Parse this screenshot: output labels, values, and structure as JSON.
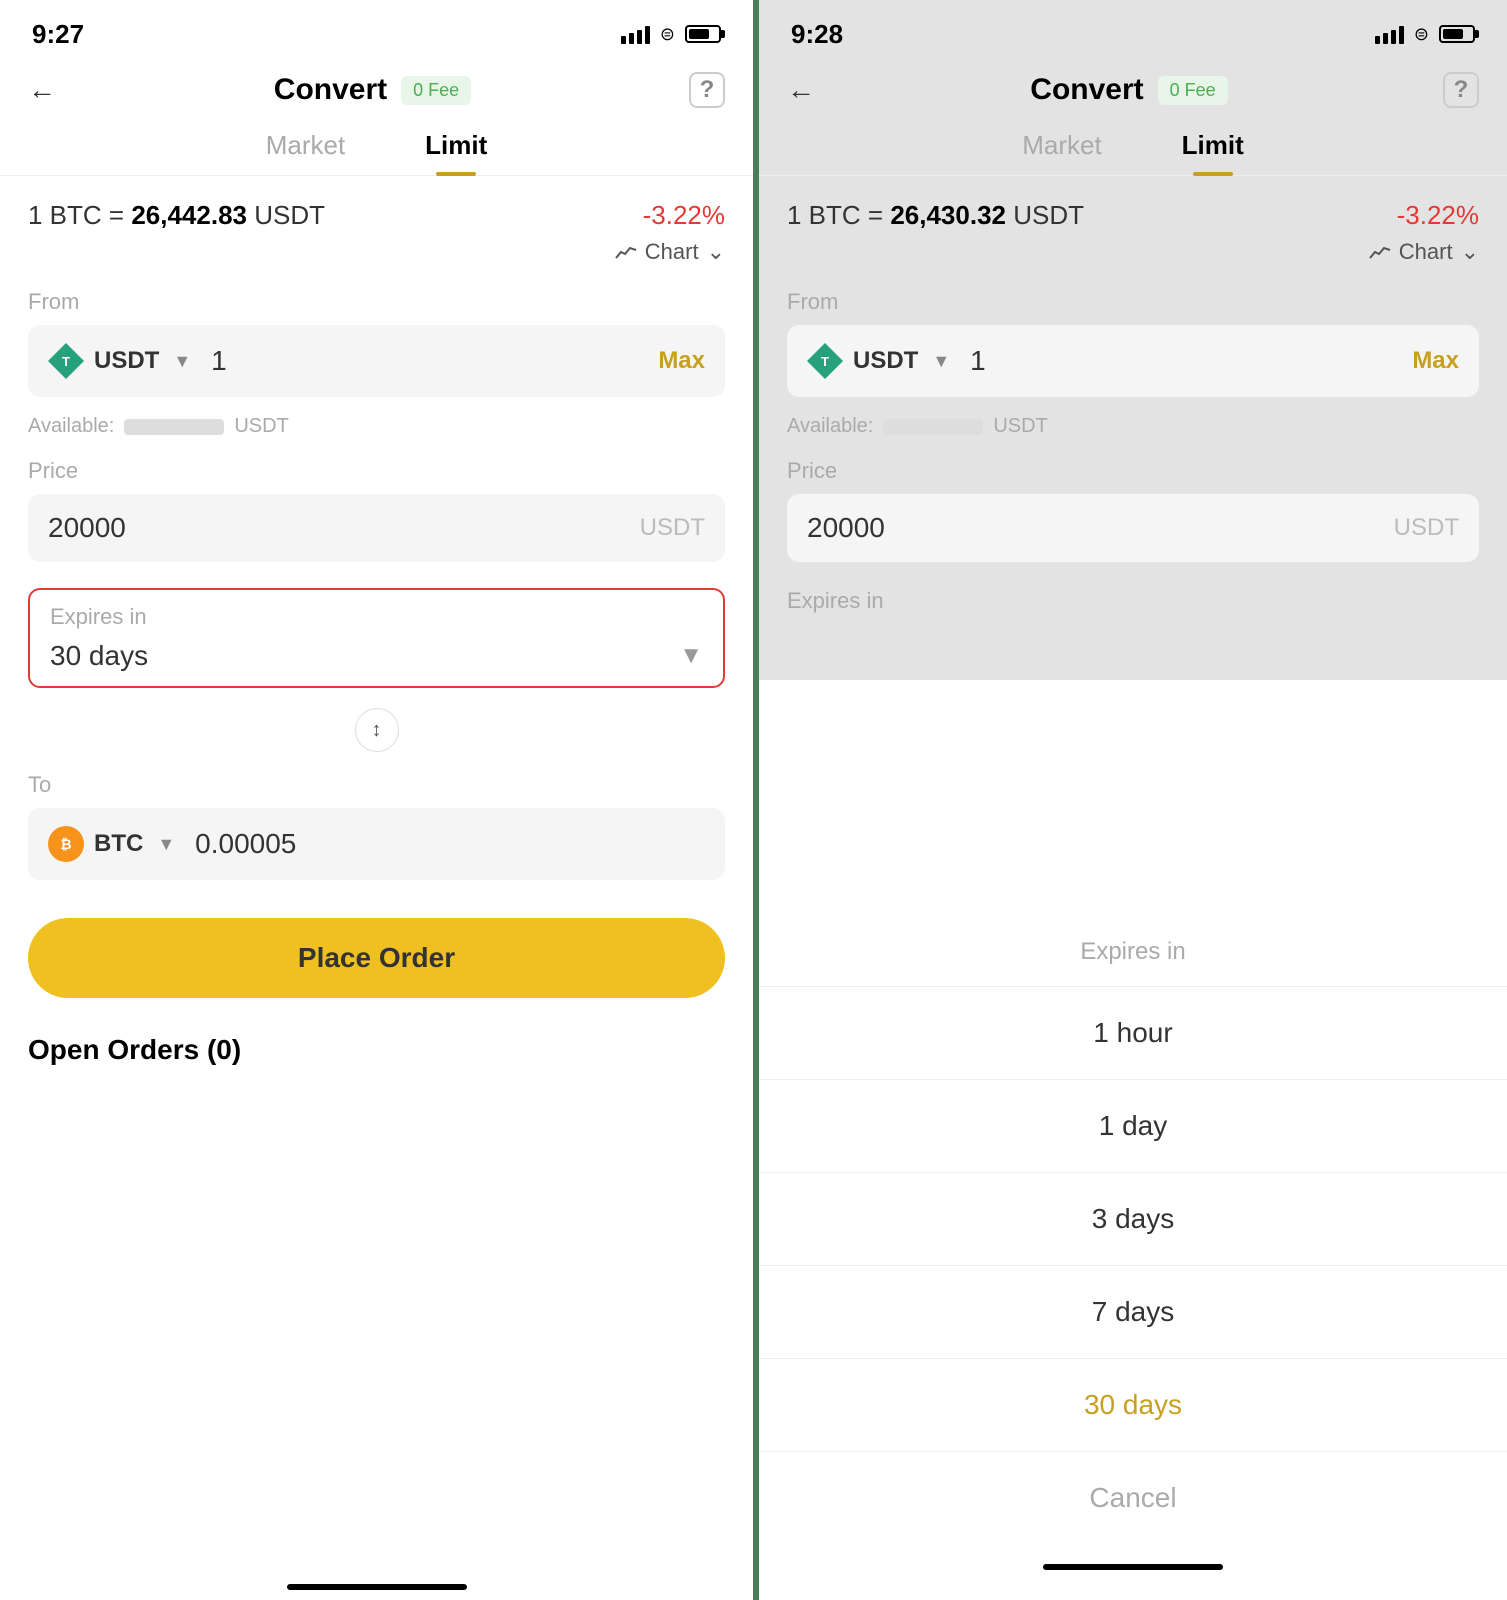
{
  "left": {
    "statusBar": {
      "time": "9:27"
    },
    "nav": {
      "title": "Convert",
      "feeBadge": "0 Fee"
    },
    "tabs": {
      "market": "Market",
      "limit": "Limit"
    },
    "rate": {
      "prefix": "1 BTC =",
      "value": "26,442.83",
      "unit": "USDT",
      "change": "-3.22%"
    },
    "chart": {
      "label": "Chart",
      "chevron": "⌄"
    },
    "from": {
      "label": "From",
      "currency": "USDT",
      "value": "1",
      "maxLabel": "Max",
      "availableLabel": "Available:",
      "availableUnit": "USDT"
    },
    "price": {
      "label": "Price",
      "value": "20000",
      "unit": "USDT"
    },
    "expires": {
      "label": "Expires in",
      "value": "30 days"
    },
    "to": {
      "label": "To",
      "currency": "BTC",
      "value": "0.00005"
    },
    "placeOrder": {
      "label": "Place Order"
    },
    "openOrders": {
      "label": "Open Orders (0)"
    }
  },
  "right": {
    "statusBar": {
      "time": "9:28"
    },
    "nav": {
      "title": "Convert",
      "feeBadge": "0 Fee"
    },
    "tabs": {
      "market": "Market",
      "limit": "Limit"
    },
    "rate": {
      "prefix": "1 BTC =",
      "value": "26,430.32",
      "unit": "USDT",
      "change": "-3.22%"
    },
    "chart": {
      "label": "Chart",
      "chevron": "⌄"
    },
    "from": {
      "label": "From",
      "currency": "USDT",
      "value": "1",
      "maxLabel": "Max",
      "availableLabel": "Available:",
      "availableUnit": "USDT"
    },
    "price": {
      "label": "Price",
      "value": "20000",
      "unit": "USDT"
    },
    "expires": {
      "label": "Expires in"
    },
    "dropdown": {
      "header": "Expires in",
      "items": [
        {
          "label": "1 hour",
          "selected": false
        },
        {
          "label": "1 day",
          "selected": false
        },
        {
          "label": "3 days",
          "selected": false
        },
        {
          "label": "7 days",
          "selected": false
        },
        {
          "label": "30 days",
          "selected": true
        },
        {
          "label": "Cancel",
          "isCancel": true
        }
      ]
    }
  }
}
